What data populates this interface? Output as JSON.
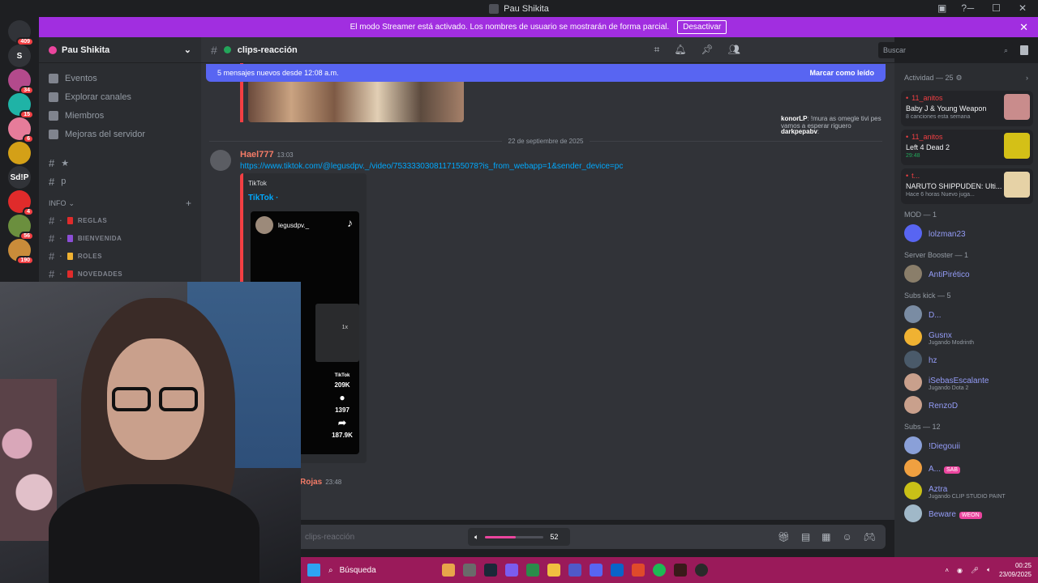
{
  "window": {
    "title": "Pau Shikita"
  },
  "streamer_banner": {
    "text": "El modo Streamer está activado. Los nombres de usuario se mostrarán de forma parcial.",
    "button": "Desactivar"
  },
  "guilds": [
    {
      "label": "",
      "badge": "409",
      "color": "#313338"
    },
    {
      "label": "S",
      "badge": "",
      "color": "#313338"
    },
    {
      "label": "",
      "badge": "34",
      "color": "#b34a8c"
    },
    {
      "label": "",
      "badge": "15",
      "color": "#1fb3a6"
    },
    {
      "label": "",
      "badge": "6",
      "color": "#e67c9a"
    },
    {
      "label": "",
      "badge": "",
      "color": "#d4a017"
    },
    {
      "label": "Sd!P",
      "badge": "",
      "color": "#313338"
    },
    {
      "label": "",
      "badge": "4",
      "color": "#e02b2b"
    },
    {
      "label": "",
      "badge": "56",
      "color": "#6b8f3e"
    },
    {
      "label": "",
      "badge": "190",
      "color": "#c98c3a"
    }
  ],
  "server": {
    "name": "Pau Shikita"
  },
  "sidebar": {
    "items": [
      {
        "label": "Eventos"
      },
      {
        "label": "Explorar canales"
      },
      {
        "label": "Miembros"
      },
      {
        "label": "Mejoras del servidor"
      }
    ],
    "loose_channels": [
      "★",
      "p"
    ],
    "category": "INFO",
    "channels": [
      {
        "name": "REGLAS",
        "color": "#e02b2b"
      },
      {
        "name": "BIENVENIDA",
        "color": "#8c4ed6"
      },
      {
        "name": "ROLES",
        "color": "#f0b232"
      },
      {
        "name": "NOVEDADES",
        "color": "#e02b2b"
      }
    ]
  },
  "channel": {
    "name": "clips-reacción"
  },
  "search": {
    "placeholder": "Buscar"
  },
  "new_messages": {
    "text": "5 mensajes nuevos desde 12:08 a.m.",
    "action": "Marcar como leído"
  },
  "chat": {
    "date_divider": "22 de septiembre de 2025",
    "message": {
      "author": "Hael777",
      "time": "13:03",
      "link": "https://www.tiktok.com/@legusdpv._/video/7533330308117155078?is_from_webapp=1&sender_device=pc",
      "embed": {
        "provider": "TikTok",
        "title": "TikTok ·",
        "user": "legusdpv._",
        "overlay": "TikTok",
        "speed": "1x",
        "likes": "209K",
        "comments": "1397",
        "shares": "187.9K"
      }
    },
    "next_author": "Rojas",
    "next_time": "23:48",
    "overlay_messages": [
      {
        "user": "konorLP",
        "text": ": !mura as omegle tivi pes vamos a esperar riguero"
      },
      {
        "user": "darkpepabv",
        "text": ":"
      }
    ]
  },
  "input": {
    "placeholder": "clips-reacción"
  },
  "volume": {
    "value": 52,
    "label": "52"
  },
  "members": {
    "activity_title": "Actividad — 25",
    "activity": [
      {
        "user": "11_anitos",
        "game": "Baby J & Young Weapon",
        "status": "8 canciones esta semana",
        "thumb": "#c98c8c"
      },
      {
        "user": "11_anitos",
        "game": "Left 4 Dead 2",
        "status": "29:48",
        "thumb": "#d4c017"
      },
      {
        "user": "t...",
        "game": "NARUTO SHIPPUDEN: Ulti...",
        "status": "Hace 6 horas  Nuevo juga...",
        "thumb": "#e6d2a6"
      }
    ],
    "groups": [
      {
        "title": "MOD — 1",
        "members": [
          {
            "name": "lolzman23",
            "sub": "",
            "tag": "",
            "color": "#5865f2"
          }
        ]
      },
      {
        "title": "Server Booster — 1",
        "members": [
          {
            "name": "AntiPirético",
            "sub": "",
            "tag": "",
            "color": "#8a7e6a"
          }
        ]
      },
      {
        "title": "Subs kick — 5",
        "members": [
          {
            "name": "D...",
            "sub": "",
            "tag": "",
            "color": "#7a8ca3"
          },
          {
            "name": "Gusnx",
            "sub": "Jugando Modrinth",
            "tag": "",
            "color": "#f0b232"
          },
          {
            "name": "hz",
            "sub": "",
            "tag": "",
            "color": "#4a5a6a"
          },
          {
            "name": "iSebasEscalante",
            "sub": "Jugando Dota 2",
            "tag": "",
            "color": "#c9a08c"
          },
          {
            "name": "RenzoD",
            "sub": "",
            "tag": "",
            "color": "#c9a08c"
          }
        ]
      },
      {
        "title": "Subs — 12",
        "members": [
          {
            "name": "!Diegouii",
            "sub": "",
            "tag": "",
            "color": "#8aa0d8"
          },
          {
            "name": "A...",
            "sub": "",
            "tag": "SAB",
            "color": "#f0a040"
          },
          {
            "name": "Aztra",
            "sub": "Jugando CLIP STUDIO PAINT",
            "tag": "",
            "color": "#c9c017"
          },
          {
            "name": "Beware",
            "sub": "",
            "tag": "WEON",
            "color": "#a0b8c8"
          }
        ]
      }
    ]
  },
  "taskbar": {
    "search": "Búsqueda",
    "time": "00:25",
    "date": "23/09/2025"
  }
}
